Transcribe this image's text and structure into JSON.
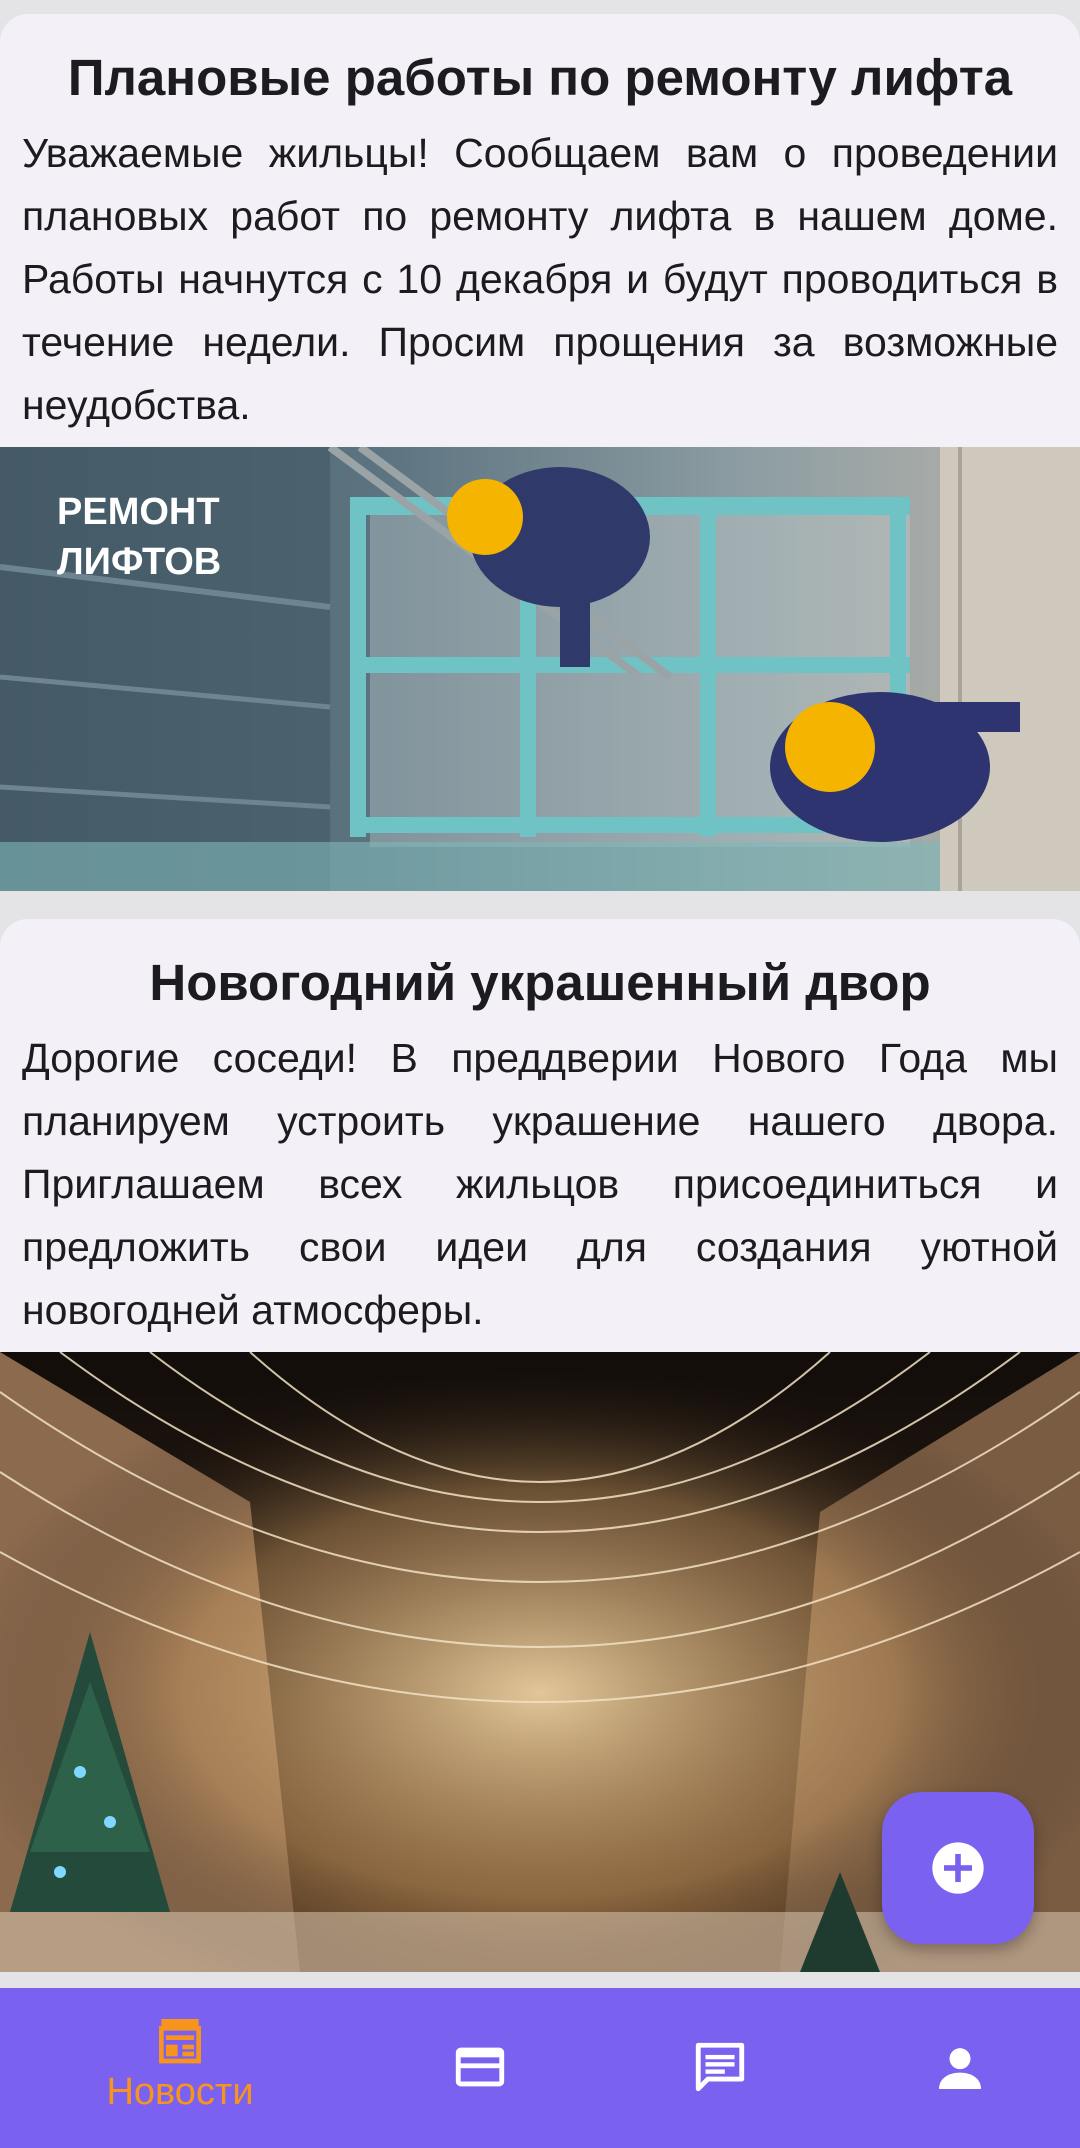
{
  "posts": [
    {
      "title": "Плановые работы по ремонту лифта",
      "body": "Уважаемые жильцы! Сообщаем вам о проведении плановых работ по ремонту лифта в нашем доме. Работы начнутся с 10 декабря и будут проводиться в течение недели. Просим прощения за возможные неудобства.",
      "image_caption": "РЕМОНТ\nЛИФТОВ"
    },
    {
      "title": "Новогодний украшенный двор",
      "body": "Дорогие соседи! В преддверии Нового Года мы планируем устроить украшение нашего двора. Приглашаем всех жильцов присоединиться и предложить свои идеи для создания уютной новогодней атмосферы."
    }
  ],
  "fab": {
    "icon": "add-circle-icon"
  },
  "bottom_nav": {
    "items": [
      {
        "icon": "news-icon",
        "label": "Новости",
        "active": true
      },
      {
        "icon": "payment-card-icon"
      },
      {
        "icon": "chat-icon"
      },
      {
        "icon": "profile-icon"
      }
    ]
  },
  "colors": {
    "accent": "#7b61ef",
    "active_nav": "#f7941d",
    "card_background": "#f4f0f7",
    "text": "#1c1b1f"
  }
}
